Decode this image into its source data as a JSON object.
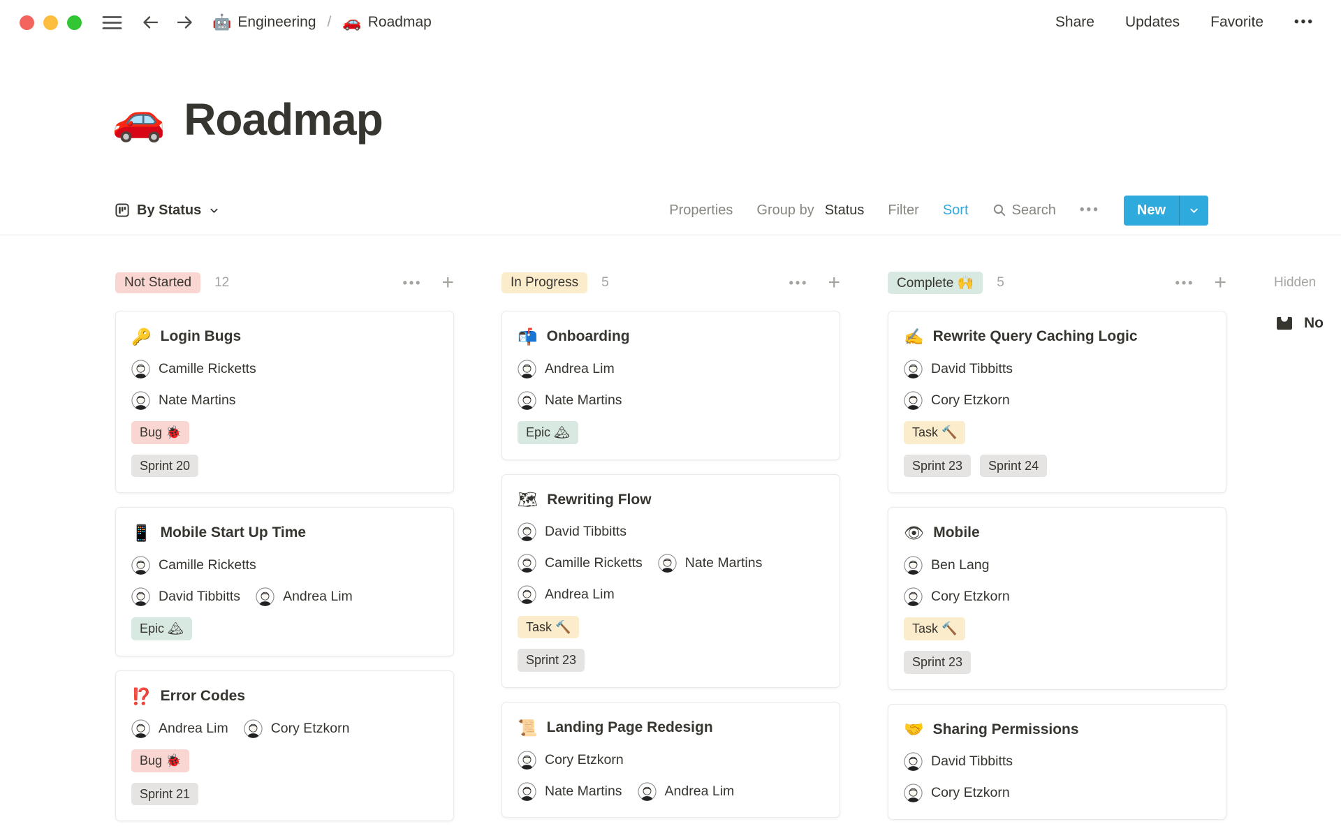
{
  "topbar": {
    "breadcrumb": [
      {
        "icon": "🤖",
        "label": "Engineering"
      },
      {
        "icon": "🚗",
        "label": "Roadmap"
      }
    ],
    "separator": "/",
    "actions": [
      {
        "label": "Share"
      },
      {
        "label": "Updates"
      },
      {
        "label": "Favorite"
      }
    ],
    "more_icon": "•••"
  },
  "page": {
    "icon": "🚗",
    "title": "Roadmap"
  },
  "toolbar": {
    "view_label": "By Status",
    "properties": "Properties",
    "group_by": "Group by",
    "group_by_value": "Status",
    "filter": "Filter",
    "sort": "Sort",
    "search": "Search",
    "more_icon": "•••",
    "new_label": "New"
  },
  "colors": {
    "accent_blue": "#2EAADC",
    "tag_red": "#FAD6D3",
    "tag_yellow": "#FBEDCC",
    "tag_green": "#D7E9E0",
    "tag_gray": "#E5E4E2",
    "traffic_red": "#F4645F",
    "traffic_yellow": "#FDBD3E",
    "traffic_green": "#32C635"
  },
  "board": {
    "columns": [
      {
        "name": "Not Started",
        "count": "12",
        "cards": [
          {
            "icon": "🔑",
            "title": "Login Bugs",
            "rows": [
              {
                "people": [
                  {
                    "name": "Camille Ricketts"
                  }
                ]
              },
              {
                "people": [
                  {
                    "name": "Nate Martins"
                  }
                ]
              },
              {
                "tags": [
                  {
                    "label": "Bug 🐞"
                  }
                ]
              },
              {
                "tags": [
                  {
                    "label": "Sprint 20"
                  }
                ]
              }
            ]
          },
          {
            "icon": "📱",
            "title": "Mobile Start Up Time",
            "rows": [
              {
                "people": [
                  {
                    "name": "Camille Ricketts"
                  }
                ]
              },
              {
                "people": [
                  {
                    "name": "David Tibbitts"
                  },
                  {
                    "name": "Andrea Lim"
                  }
                ]
              },
              {
                "tags": [
                  {
                    "label": "Epic 🏔"
                  }
                ]
              }
            ]
          },
          {
            "icon": "⁉️",
            "title": "Error Codes",
            "rows": [
              {
                "people": [
                  {
                    "name": "Andrea Lim"
                  },
                  {
                    "name": "Cory Etzkorn"
                  }
                ]
              },
              {
                "tags": [
                  {
                    "label": "Bug 🐞"
                  }
                ]
              },
              {
                "tags": [
                  {
                    "label": "Sprint 21"
                  }
                ]
              }
            ]
          }
        ]
      },
      {
        "name": "In Progress",
        "count": "5",
        "cards": [
          {
            "icon": "📬",
            "title": "Onboarding",
            "rows": [
              {
                "people": [
                  {
                    "name": "Andrea Lim"
                  }
                ]
              },
              {
                "people": [
                  {
                    "name": "Nate Martins"
                  }
                ]
              },
              {
                "tags": [
                  {
                    "label": "Epic 🏔"
                  }
                ]
              }
            ]
          },
          {
            "icon": "🗺",
            "title": "Rewriting Flow",
            "rows": [
              {
                "people": [
                  {
                    "name": "David Tibbitts"
                  }
                ]
              },
              {
                "people": [
                  {
                    "name": "Camille Ricketts"
                  },
                  {
                    "name": "Nate Martins"
                  }
                ]
              },
              {
                "people": [
                  {
                    "name": "Andrea Lim"
                  }
                ]
              },
              {
                "tags": [
                  {
                    "label": "Task 🔨"
                  }
                ]
              },
              {
                "tags": [
                  {
                    "label": "Sprint 23"
                  }
                ]
              }
            ]
          },
          {
            "icon": "📜",
            "title": "Landing Page Redesign",
            "rows": [
              {
                "people": [
                  {
                    "name": "Cory Etzkorn"
                  }
                ]
              },
              {
                "people": [
                  {
                    "name": "Nate Martins"
                  },
                  {
                    "name": "Andrea Lim"
                  }
                ]
              }
            ]
          }
        ]
      },
      {
        "name": "Complete 🙌",
        "count": "5",
        "cards": [
          {
            "icon": "✍️",
            "title": "Rewrite Query Caching Logic",
            "rows": [
              {
                "people": [
                  {
                    "name": "David Tibbitts"
                  }
                ]
              },
              {
                "people": [
                  {
                    "name": "Cory Etzkorn"
                  }
                ]
              },
              {
                "tags": [
                  {
                    "label": "Task 🔨"
                  }
                ]
              },
              {
                "tags": [
                  {
                    "label": "Sprint 23"
                  },
                  {
                    "label": "Sprint 24"
                  }
                ]
              }
            ]
          },
          {
            "icon": "👁",
            "title": "Mobile",
            "rows": [
              {
                "people": [
                  {
                    "name": "Ben Lang"
                  }
                ]
              },
              {
                "people": [
                  {
                    "name": "Cory Etzkorn"
                  }
                ]
              },
              {
                "tags": [
                  {
                    "label": "Task 🔨"
                  }
                ]
              },
              {
                "tags": [
                  {
                    "label": "Sprint 23"
                  }
                ]
              }
            ]
          },
          {
            "icon": "🤝",
            "title": "Sharing Permissions",
            "rows": [
              {
                "people": [
                  {
                    "name": "David Tibbitts"
                  }
                ]
              },
              {
                "people": [
                  {
                    "name": "Cory Etzkorn"
                  }
                ]
              }
            ]
          }
        ]
      }
    ],
    "hidden_group": {
      "label": "Hidden",
      "item_text": "No"
    }
  }
}
